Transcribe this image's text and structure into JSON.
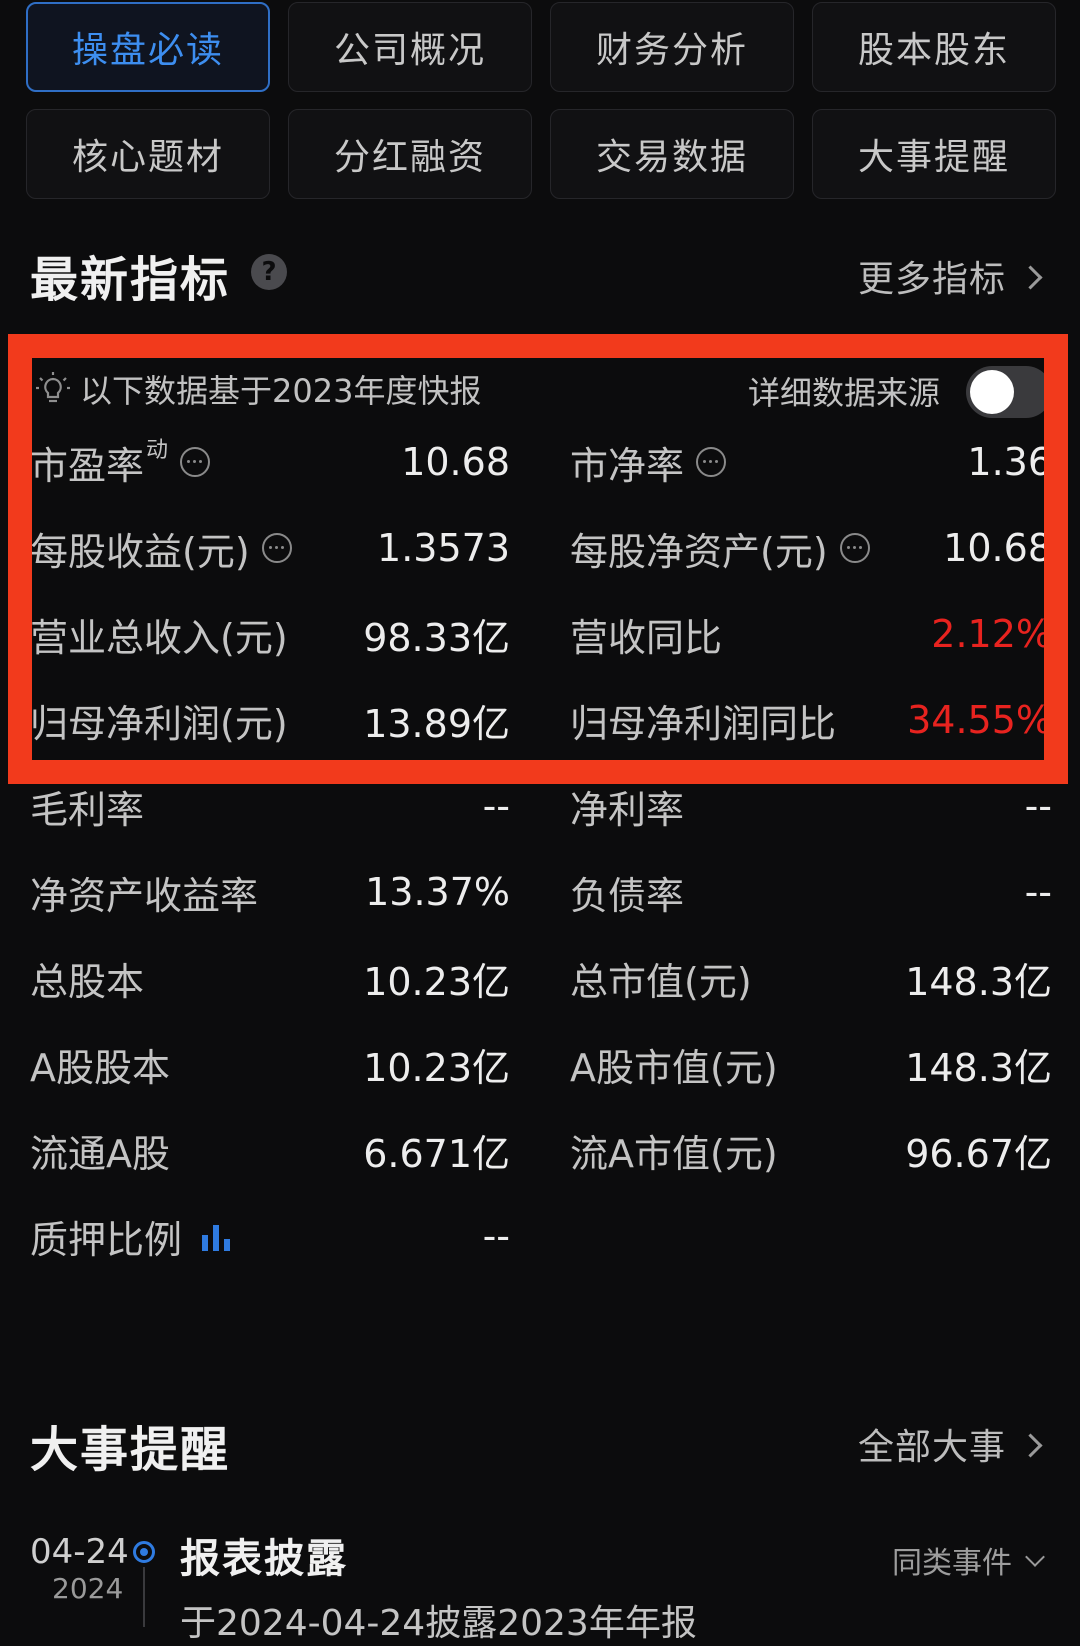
{
  "tabs": [
    {
      "label": "操盘必读",
      "active": true
    },
    {
      "label": "公司概况"
    },
    {
      "label": "财务分析"
    },
    {
      "label": "股本股东"
    },
    {
      "label": "核心题材"
    },
    {
      "label": "分红融资"
    },
    {
      "label": "交易数据"
    },
    {
      "label": "大事提醒"
    }
  ],
  "indicators": {
    "title": "最新指标",
    "more_label": "更多指标",
    "notice": "以下数据基于2023年度快报",
    "source_label": "详细数据来源",
    "source_toggle_on": false,
    "left": [
      {
        "label": "市盈率",
        "sup": "动",
        "value": "10.68"
      },
      {
        "label": "每股收益(元)",
        "value": "1.3573"
      },
      {
        "label": "营业总收入(元)",
        "value": "98.33亿"
      },
      {
        "label": "归母净利润(元)",
        "value": "13.89亿"
      },
      {
        "label": "毛利率",
        "value": "--"
      },
      {
        "label": "净资产收益率",
        "value": "13.37%"
      },
      {
        "label": "总股本",
        "value": "10.23亿"
      },
      {
        "label": "A股股本",
        "value": "10.23亿"
      },
      {
        "label": "流通A股",
        "value": "6.671亿"
      },
      {
        "label": "质押比例",
        "value": "--"
      }
    ],
    "right": [
      {
        "label": "市净率",
        "value": "1.36"
      },
      {
        "label": "每股净资产(元)",
        "value": "10.68"
      },
      {
        "label": "营收同比",
        "value": "2.12%"
      },
      {
        "label": "归母净利润同比",
        "value": "34.55%"
      },
      {
        "label": "净利率",
        "value": "--"
      },
      {
        "label": "负债率",
        "value": "--"
      },
      {
        "label": "总市值(元)",
        "value": "148.3亿"
      },
      {
        "label": "A股市值(元)",
        "value": "148.3亿"
      },
      {
        "label": "流A市值(元)",
        "value": "96.67亿"
      }
    ]
  },
  "events": {
    "title": "大事提醒",
    "more_label": "全部大事",
    "items": [
      {
        "date": "04-24",
        "year": "2024",
        "title": "报表披露",
        "similar_label": "同类事件",
        "desc": "于2024-04-24披露2023年年报"
      }
    ]
  },
  "colors": {
    "accent": "#3d8ef0",
    "negative_up": "#e8231f",
    "highlight": "#f23a1c"
  }
}
